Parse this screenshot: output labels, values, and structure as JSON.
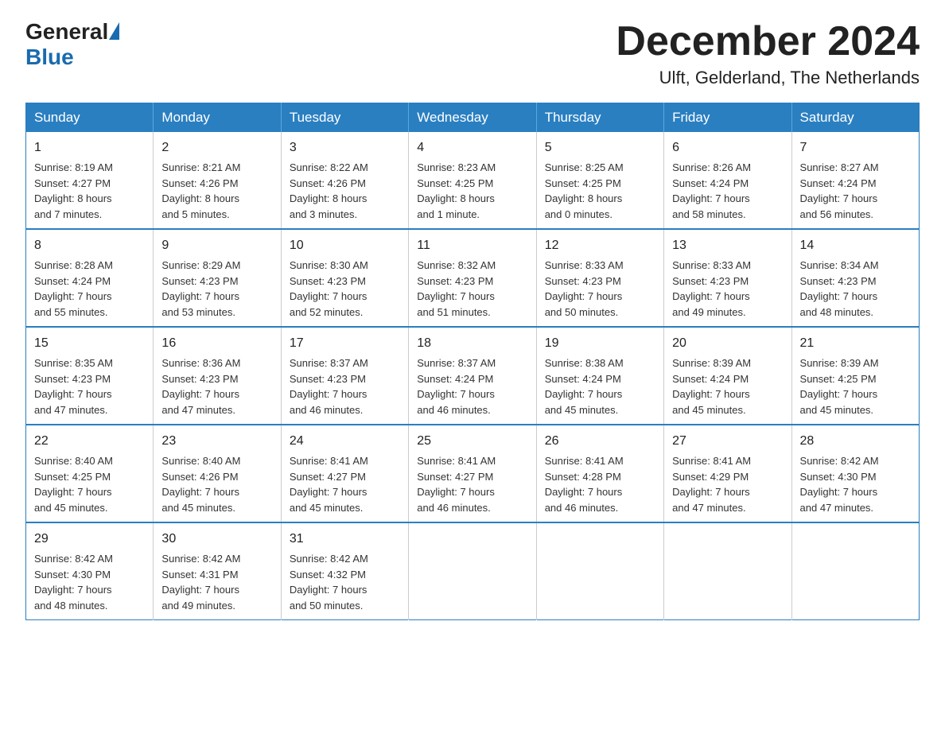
{
  "header": {
    "logo_general": "General",
    "logo_blue": "Blue",
    "month_title": "December 2024",
    "location": "Ulft, Gelderland, The Netherlands"
  },
  "days_of_week": [
    "Sunday",
    "Monday",
    "Tuesday",
    "Wednesday",
    "Thursday",
    "Friday",
    "Saturday"
  ],
  "weeks": [
    [
      {
        "day": "1",
        "sunrise": "Sunrise: 8:19 AM",
        "sunset": "Sunset: 4:27 PM",
        "daylight": "Daylight: 8 hours",
        "daylight2": "and 7 minutes."
      },
      {
        "day": "2",
        "sunrise": "Sunrise: 8:21 AM",
        "sunset": "Sunset: 4:26 PM",
        "daylight": "Daylight: 8 hours",
        "daylight2": "and 5 minutes."
      },
      {
        "day": "3",
        "sunrise": "Sunrise: 8:22 AM",
        "sunset": "Sunset: 4:26 PM",
        "daylight": "Daylight: 8 hours",
        "daylight2": "and 3 minutes."
      },
      {
        "day": "4",
        "sunrise": "Sunrise: 8:23 AM",
        "sunset": "Sunset: 4:25 PM",
        "daylight": "Daylight: 8 hours",
        "daylight2": "and 1 minute."
      },
      {
        "day": "5",
        "sunrise": "Sunrise: 8:25 AM",
        "sunset": "Sunset: 4:25 PM",
        "daylight": "Daylight: 8 hours",
        "daylight2": "and 0 minutes."
      },
      {
        "day": "6",
        "sunrise": "Sunrise: 8:26 AM",
        "sunset": "Sunset: 4:24 PM",
        "daylight": "Daylight: 7 hours",
        "daylight2": "and 58 minutes."
      },
      {
        "day": "7",
        "sunrise": "Sunrise: 8:27 AM",
        "sunset": "Sunset: 4:24 PM",
        "daylight": "Daylight: 7 hours",
        "daylight2": "and 56 minutes."
      }
    ],
    [
      {
        "day": "8",
        "sunrise": "Sunrise: 8:28 AM",
        "sunset": "Sunset: 4:24 PM",
        "daylight": "Daylight: 7 hours",
        "daylight2": "and 55 minutes."
      },
      {
        "day": "9",
        "sunrise": "Sunrise: 8:29 AM",
        "sunset": "Sunset: 4:23 PM",
        "daylight": "Daylight: 7 hours",
        "daylight2": "and 53 minutes."
      },
      {
        "day": "10",
        "sunrise": "Sunrise: 8:30 AM",
        "sunset": "Sunset: 4:23 PM",
        "daylight": "Daylight: 7 hours",
        "daylight2": "and 52 minutes."
      },
      {
        "day": "11",
        "sunrise": "Sunrise: 8:32 AM",
        "sunset": "Sunset: 4:23 PM",
        "daylight": "Daylight: 7 hours",
        "daylight2": "and 51 minutes."
      },
      {
        "day": "12",
        "sunrise": "Sunrise: 8:33 AM",
        "sunset": "Sunset: 4:23 PM",
        "daylight": "Daylight: 7 hours",
        "daylight2": "and 50 minutes."
      },
      {
        "day": "13",
        "sunrise": "Sunrise: 8:33 AM",
        "sunset": "Sunset: 4:23 PM",
        "daylight": "Daylight: 7 hours",
        "daylight2": "and 49 minutes."
      },
      {
        "day": "14",
        "sunrise": "Sunrise: 8:34 AM",
        "sunset": "Sunset: 4:23 PM",
        "daylight": "Daylight: 7 hours",
        "daylight2": "and 48 minutes."
      }
    ],
    [
      {
        "day": "15",
        "sunrise": "Sunrise: 8:35 AM",
        "sunset": "Sunset: 4:23 PM",
        "daylight": "Daylight: 7 hours",
        "daylight2": "and 47 minutes."
      },
      {
        "day": "16",
        "sunrise": "Sunrise: 8:36 AM",
        "sunset": "Sunset: 4:23 PM",
        "daylight": "Daylight: 7 hours",
        "daylight2": "and 47 minutes."
      },
      {
        "day": "17",
        "sunrise": "Sunrise: 8:37 AM",
        "sunset": "Sunset: 4:23 PM",
        "daylight": "Daylight: 7 hours",
        "daylight2": "and 46 minutes."
      },
      {
        "day": "18",
        "sunrise": "Sunrise: 8:37 AM",
        "sunset": "Sunset: 4:24 PM",
        "daylight": "Daylight: 7 hours",
        "daylight2": "and 46 minutes."
      },
      {
        "day": "19",
        "sunrise": "Sunrise: 8:38 AM",
        "sunset": "Sunset: 4:24 PM",
        "daylight": "Daylight: 7 hours",
        "daylight2": "and 45 minutes."
      },
      {
        "day": "20",
        "sunrise": "Sunrise: 8:39 AM",
        "sunset": "Sunset: 4:24 PM",
        "daylight": "Daylight: 7 hours",
        "daylight2": "and 45 minutes."
      },
      {
        "day": "21",
        "sunrise": "Sunrise: 8:39 AM",
        "sunset": "Sunset: 4:25 PM",
        "daylight": "Daylight: 7 hours",
        "daylight2": "and 45 minutes."
      }
    ],
    [
      {
        "day": "22",
        "sunrise": "Sunrise: 8:40 AM",
        "sunset": "Sunset: 4:25 PM",
        "daylight": "Daylight: 7 hours",
        "daylight2": "and 45 minutes."
      },
      {
        "day": "23",
        "sunrise": "Sunrise: 8:40 AM",
        "sunset": "Sunset: 4:26 PM",
        "daylight": "Daylight: 7 hours",
        "daylight2": "and 45 minutes."
      },
      {
        "day": "24",
        "sunrise": "Sunrise: 8:41 AM",
        "sunset": "Sunset: 4:27 PM",
        "daylight": "Daylight: 7 hours",
        "daylight2": "and 45 minutes."
      },
      {
        "day": "25",
        "sunrise": "Sunrise: 8:41 AM",
        "sunset": "Sunset: 4:27 PM",
        "daylight": "Daylight: 7 hours",
        "daylight2": "and 46 minutes."
      },
      {
        "day": "26",
        "sunrise": "Sunrise: 8:41 AM",
        "sunset": "Sunset: 4:28 PM",
        "daylight": "Daylight: 7 hours",
        "daylight2": "and 46 minutes."
      },
      {
        "day": "27",
        "sunrise": "Sunrise: 8:41 AM",
        "sunset": "Sunset: 4:29 PM",
        "daylight": "Daylight: 7 hours",
        "daylight2": "and 47 minutes."
      },
      {
        "day": "28",
        "sunrise": "Sunrise: 8:42 AM",
        "sunset": "Sunset: 4:30 PM",
        "daylight": "Daylight: 7 hours",
        "daylight2": "and 47 minutes."
      }
    ],
    [
      {
        "day": "29",
        "sunrise": "Sunrise: 8:42 AM",
        "sunset": "Sunset: 4:30 PM",
        "daylight": "Daylight: 7 hours",
        "daylight2": "and 48 minutes."
      },
      {
        "day": "30",
        "sunrise": "Sunrise: 8:42 AM",
        "sunset": "Sunset: 4:31 PM",
        "daylight": "Daylight: 7 hours",
        "daylight2": "and 49 minutes."
      },
      {
        "day": "31",
        "sunrise": "Sunrise: 8:42 AM",
        "sunset": "Sunset: 4:32 PM",
        "daylight": "Daylight: 7 hours",
        "daylight2": "and 50 minutes."
      },
      null,
      null,
      null,
      null
    ]
  ]
}
